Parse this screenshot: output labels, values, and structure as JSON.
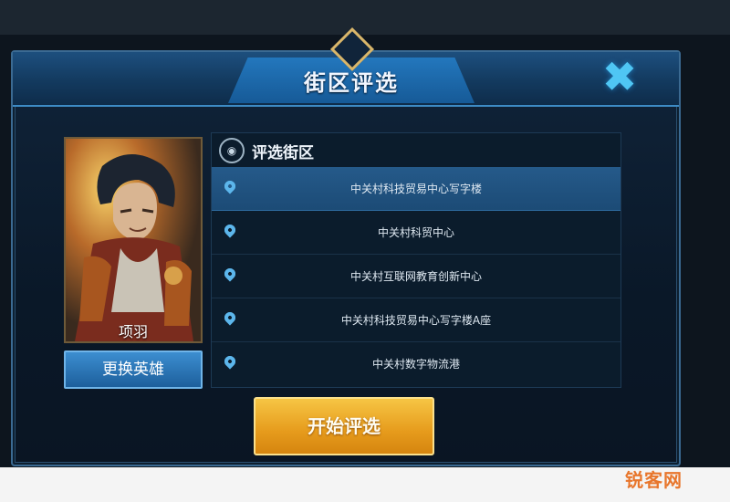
{
  "dialog": {
    "title": "街区评选",
    "close_icon": "close-icon"
  },
  "hero": {
    "name": "项羽",
    "change_button_label": "更换英雄"
  },
  "district_section": {
    "title": "评选街区",
    "header_icon": "map-pin-icon",
    "items": [
      {
        "label": "中关村科技贸易中心写字楼",
        "selected": true
      },
      {
        "label": "中关村科贸中心",
        "selected": false
      },
      {
        "label": "中关村互联网教育创新中心",
        "selected": false
      },
      {
        "label": "中关村科技贸易中心写字楼A座",
        "selected": false
      },
      {
        "label": "中关村数字物流港",
        "selected": false
      }
    ]
  },
  "start_button_label": "开始评选",
  "watermark": "锐客网",
  "colors": {
    "accent": "#2377bd",
    "selected_row": "#255a8a",
    "start_button": "#e69b1c",
    "close_icon": "#4fc6f4"
  }
}
